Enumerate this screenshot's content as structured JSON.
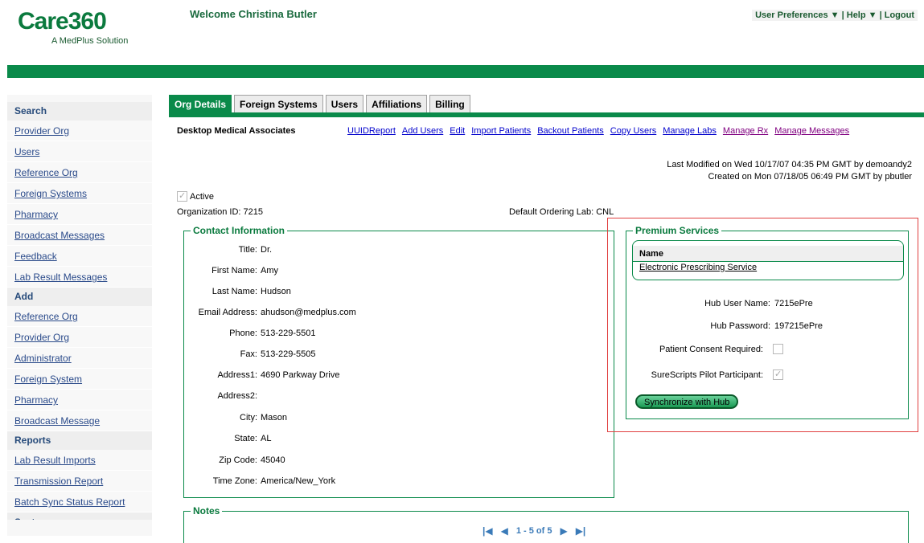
{
  "header": {
    "brand": "Care360",
    "tagline": "A MedPlus Solution",
    "welcome": "Welcome Christina Butler",
    "nav": {
      "preferences": "User Preferences ▼",
      "sep1": " | ",
      "help": "Help ▼",
      "sep2": " | ",
      "logout": "Logout"
    }
  },
  "sidebar": {
    "search_title": "Search",
    "search_items": [
      "Provider Org",
      "Users",
      "Reference Org",
      "Foreign Systems",
      "Pharmacy",
      "Broadcast Messages",
      "Feedback",
      "Lab Result Messages"
    ],
    "add_title": "Add",
    "add_items": [
      "Reference Org",
      "Provider Org",
      "Administrator",
      "Foreign System",
      "Pharmacy",
      "Broadcast Message"
    ],
    "reports_title": "Reports",
    "reports_items": [
      "Lab Result Imports",
      "Transmission Report",
      "Batch Sync Status Report"
    ],
    "system_title": "System"
  },
  "tabs": [
    "Org Details",
    "Foreign Systems",
    "Users",
    "Affiliations",
    "Billing"
  ],
  "active_tab": "Org Details",
  "org": {
    "name": "Desktop Medical Associates",
    "actions": [
      "UUIDReport",
      "Add Users",
      "Edit",
      "Import Patients",
      "Backout Patients",
      "Copy Users",
      "Manage Labs",
      "Manage Rx",
      "Manage Messages"
    ],
    "last_modified": "Last Modified on Wed 10/17/07 04:35 PM GMT by demoandy2",
    "created": "Created on Mon 07/18/05 06:49 PM GMT by pbutler",
    "active_label": "Active",
    "active_checked": true,
    "org_id": "Organization ID: 7215",
    "default_lab": "Default Ordering Lab: CNL"
  },
  "contact": {
    "legend": "Contact Information",
    "fields": [
      {
        "label": "Title:",
        "value": "Dr."
      },
      {
        "label": "First Name:",
        "value": "Amy"
      },
      {
        "label": "Last Name:",
        "value": "Hudson"
      },
      {
        "label": "Email Address:",
        "value": "ahudson@medplus.com"
      },
      {
        "label": "Phone:",
        "value": "513-229-5501"
      },
      {
        "label": "Fax:",
        "value": "513-229-5505"
      },
      {
        "label": "Address1:",
        "value": "4690 Parkway Drive"
      },
      {
        "label": "Address2:",
        "value": ""
      },
      {
        "label": "City:",
        "value": "Mason"
      },
      {
        "label": "State:",
        "value": "AL"
      },
      {
        "label": "Zip Code:",
        "value": "45040"
      },
      {
        "label": "Time Zone:",
        "value": "America/New_York"
      }
    ]
  },
  "premium": {
    "legend": "Premium Services",
    "table_header": "Name",
    "services": [
      "Electronic Prescribing Service"
    ],
    "hub_user_label": "Hub User Name:",
    "hub_user": "7215ePre",
    "hub_password_label": "Hub Password:",
    "hub_password": "197215ePre",
    "consent_label": "Patient Consent Required:",
    "consent_checked": false,
    "pilot_label": "SureScripts Pilot Participant:",
    "pilot_checked": true,
    "sync_button": "Synchronize with Hub"
  },
  "notes": {
    "legend": "Notes",
    "pager_text": "1 - 5 of 5"
  }
}
